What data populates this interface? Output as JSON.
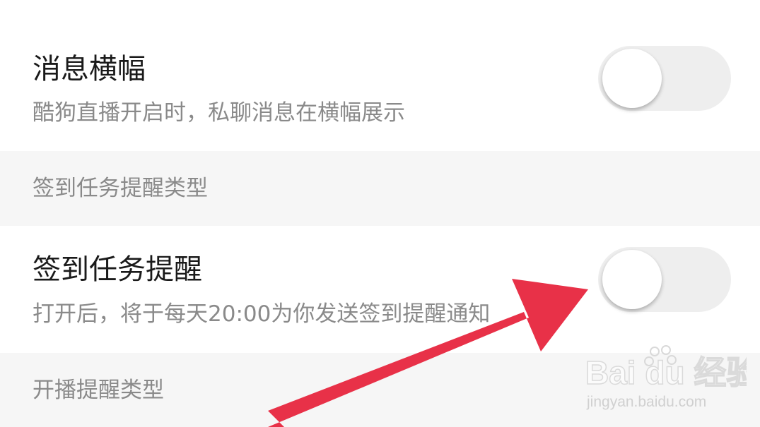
{
  "settings": {
    "message_banner": {
      "title": "消息横幅",
      "description": "酷狗直播开启时，私聊消息在横幅展示",
      "enabled": false
    },
    "checkin_section": {
      "label": "签到任务提醒类型"
    },
    "checkin_reminder": {
      "title": "签到任务提醒",
      "description": "打开后，将于每天20:00为你发送签到提醒通知",
      "enabled": false
    },
    "live_section": {
      "label": "开播提醒类型"
    }
  },
  "watermark": {
    "brand": "Bai du 经验",
    "url": "jingyan.baidu.com"
  },
  "colors": {
    "arrow": "#e83148",
    "toggle_off_track": "#eeeeee",
    "section_background": "#f6f6f6"
  }
}
